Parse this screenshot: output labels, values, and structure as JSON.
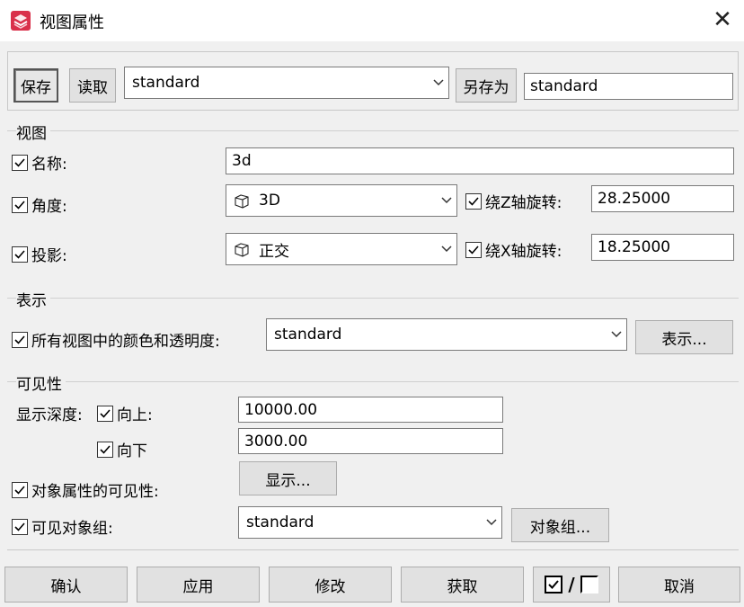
{
  "window": {
    "title": "视图属性",
    "close_glyph": "✕",
    "app_icon": "app-logo-icon"
  },
  "toolbar": {
    "save_label": "保存",
    "load_label": "读取",
    "preset_select": "standard",
    "saveas_label": "另存为",
    "saveas_name": "standard"
  },
  "view": {
    "legend": "视图",
    "name_label": "名称:",
    "name_value": "3d",
    "angle_label": "角度:",
    "angle_value": "3D",
    "rotz_label": "绕Z轴旋转:",
    "rotz_value": "28.25000",
    "projection_label": "投影:",
    "projection_value": "正交",
    "rotx_label": "绕X轴旋转:",
    "rotx_value": "18.25000"
  },
  "display": {
    "legend": "表示",
    "colors_label": "所有视图中的颜色和透明度:",
    "colors_value": "standard",
    "display_button": "表示..."
  },
  "visibility": {
    "legend": "可见性",
    "depth_label": "显示深度:",
    "up_label": "向上:",
    "up_value": "10000.00",
    "down_label": "向下",
    "down_value": "3000.00",
    "obj_attr_label": "对象属性的可见性:",
    "show_button": "显示...",
    "obj_group_label": "可见对象组:",
    "obj_group_value": "standard",
    "obj_group_button": "对象组..."
  },
  "footer": {
    "ok": "确认",
    "apply": "应用",
    "modify": "修改",
    "get": "获取",
    "toggle_separator": "/",
    "cancel": "取消"
  },
  "colors": {
    "accent": "#d9304a",
    "window_bg": "#f0f0f0",
    "button_bg": "#e1e1e1"
  }
}
